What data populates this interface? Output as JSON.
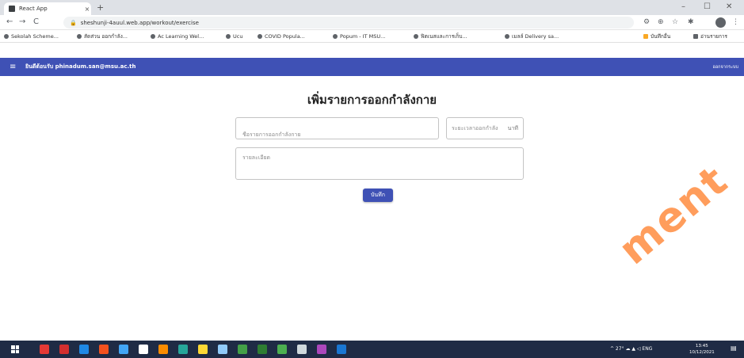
{
  "browser": {
    "tab_title": "React App",
    "tab_close": "×",
    "new_tab": "+",
    "window_controls": {
      "minimize": "–",
      "maximize": "☐",
      "close": "✕"
    },
    "nav": {
      "back": "←",
      "forward": "→",
      "reload": "C"
    },
    "url": "sheshunji-4auul.web.app/workout/exercise",
    "bookmarks": [
      "Sekolah Scheme...",
      "สัดส่วน ออกกำลัง...",
      "Ac Learning Wel...",
      "Ucu",
      "COVID Popula...",
      "Popum - IT MSU...",
      "ฟิตเนสและการเก็บ...",
      "เมลล์ Delivery sa...",
      "บันทึกอื่น",
      "อ่านรายการ"
    ]
  },
  "app": {
    "menu_icon": "≡",
    "title": "ยินดีต้อนรับ phinadum.san@msu.ac.th",
    "signout": "ออกจากระบบ"
  },
  "form": {
    "title": "เพิ่มรายการออกกำลังกาย",
    "name_placeholder": "ชื่อรายการออกกำลังกาย",
    "duration_placeholder": "ระยะเวลาออกกำลัง",
    "duration_unit": "นาที",
    "detail_placeholder": "รายละเอียด",
    "submit_label": "บันทึก"
  },
  "watermark": "ment",
  "taskbar": {
    "tray": "^ 27° ☁ ▲ ◁ ENG",
    "time": "13:45",
    "date": "10/12/2021",
    "colors": [
      "#e53935",
      "#d32f2f",
      "#1e88e5",
      "#f4511e",
      "#42a5f5",
      "#ffffff",
      "#fb8c00",
      "#26a69a",
      "#fdd835",
      "#90caf9",
      "#43a047",
      "#2e7d32",
      "#4caf50",
      "#cfd8dc",
      "#ab47bc",
      "#1976d2"
    ]
  }
}
